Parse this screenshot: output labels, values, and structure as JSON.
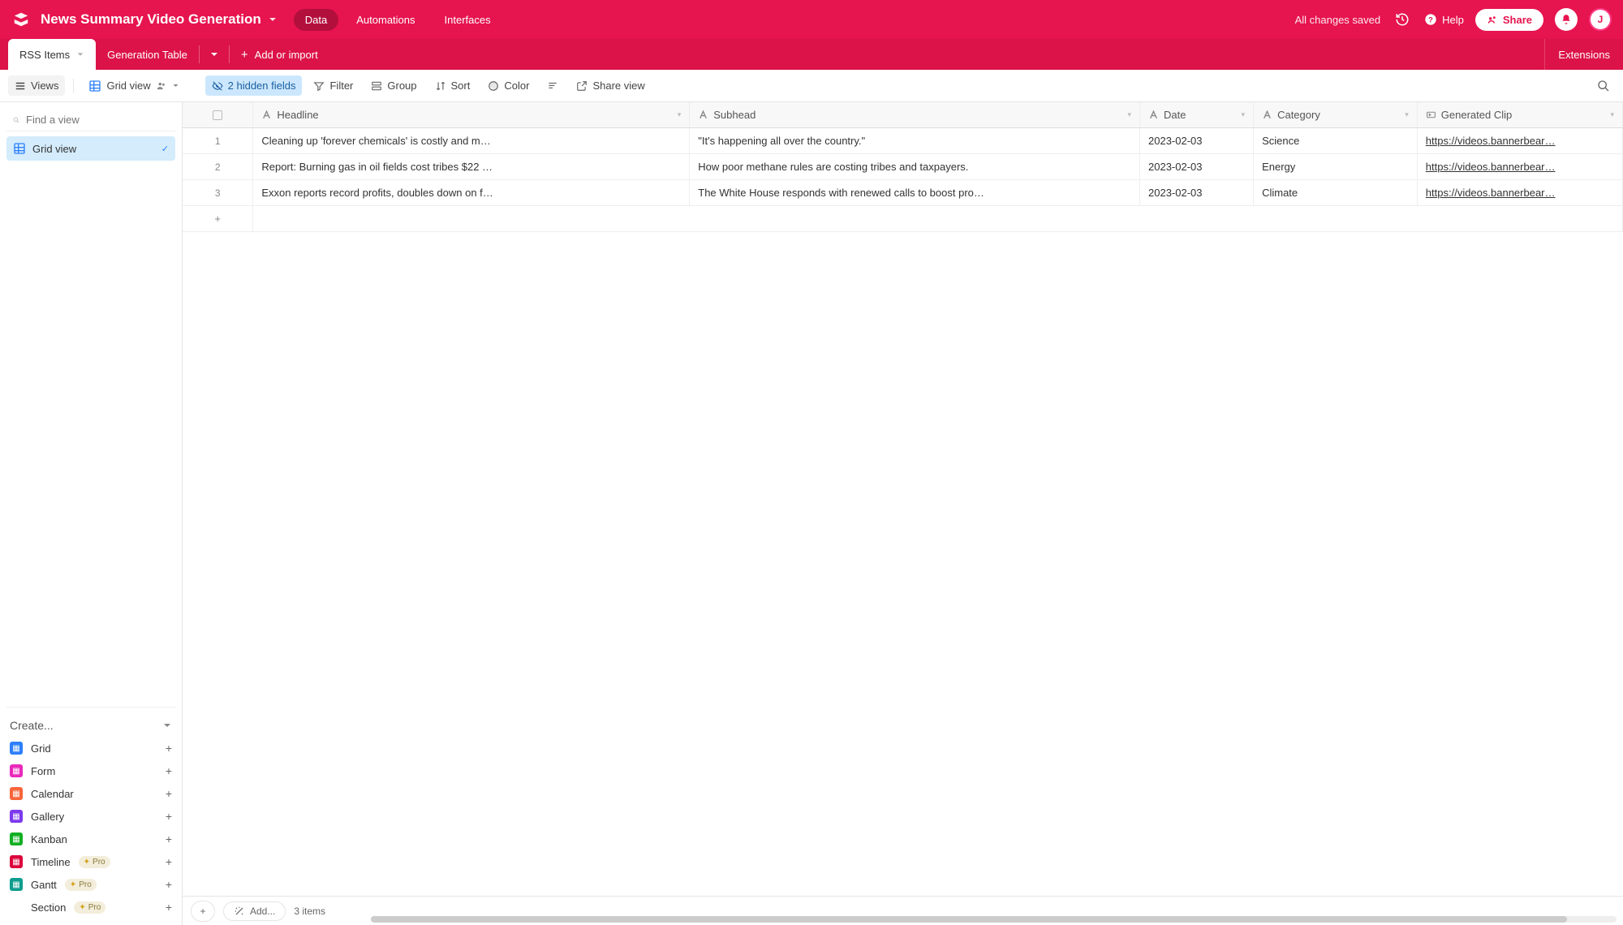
{
  "header": {
    "base_name": "News Summary Video Generation",
    "tabs": {
      "data": "Data",
      "automations": "Automations",
      "interfaces": "Interfaces"
    },
    "saved": "All changes saved",
    "help": "Help",
    "share": "Share",
    "avatar_initial": "J"
  },
  "tables": {
    "active": "RSS Items",
    "second": "Generation Table",
    "add": "Add or import",
    "extensions": "Extensions"
  },
  "toolbar": {
    "views": "Views",
    "grid_view": "Grid view",
    "hidden_fields": "2 hidden fields",
    "filter": "Filter",
    "group": "Group",
    "sort": "Sort",
    "color": "Color",
    "share_view": "Share view"
  },
  "sidebar": {
    "find_placeholder": "Find a view",
    "active_view": "Grid view",
    "create_label": "Create...",
    "items": [
      {
        "label": "Grid",
        "color": "#2d7ff9",
        "pro": false
      },
      {
        "label": "Form",
        "color": "#e929ba",
        "pro": false
      },
      {
        "label": "Calendar",
        "color": "#f7653b",
        "pro": false
      },
      {
        "label": "Gallery",
        "color": "#7c39ed",
        "pro": false
      },
      {
        "label": "Kanban",
        "color": "#11af22",
        "pro": false
      },
      {
        "label": "Timeline",
        "color": "#dc043b",
        "pro": true
      },
      {
        "label": "Gantt",
        "color": "#0f9d8f",
        "pro": true
      },
      {
        "label": "Section",
        "color": "",
        "pro": true
      }
    ],
    "pro_label": "Pro"
  },
  "columns": {
    "headline": "Headline",
    "subhead": "Subhead",
    "date": "Date",
    "category": "Category",
    "clip": "Generated Clip"
  },
  "rows": [
    {
      "n": "1",
      "headline": "Cleaning up 'forever chemicals' is costly and m…",
      "subhead": "\"It's happening all over the country.\"",
      "date": "2023-02-03",
      "category": "Science",
      "clip": "https://videos.bannerbear…"
    },
    {
      "n": "2",
      "headline": "Report: Burning gas in oil fields cost tribes $22 …",
      "subhead": "How poor methane rules are costing tribes and taxpayers.",
      "date": "2023-02-03",
      "category": "Energy",
      "clip": "https://videos.bannerbear…"
    },
    {
      "n": "3",
      "headline": "Exxon reports record profits, doubles down on f…",
      "subhead": "The White House responds with renewed calls to boost pro…",
      "date": "2023-02-03",
      "category": "Climate",
      "clip": "https://videos.bannerbear…"
    }
  ],
  "footer": {
    "add": "Add...",
    "count": "3 items"
  }
}
